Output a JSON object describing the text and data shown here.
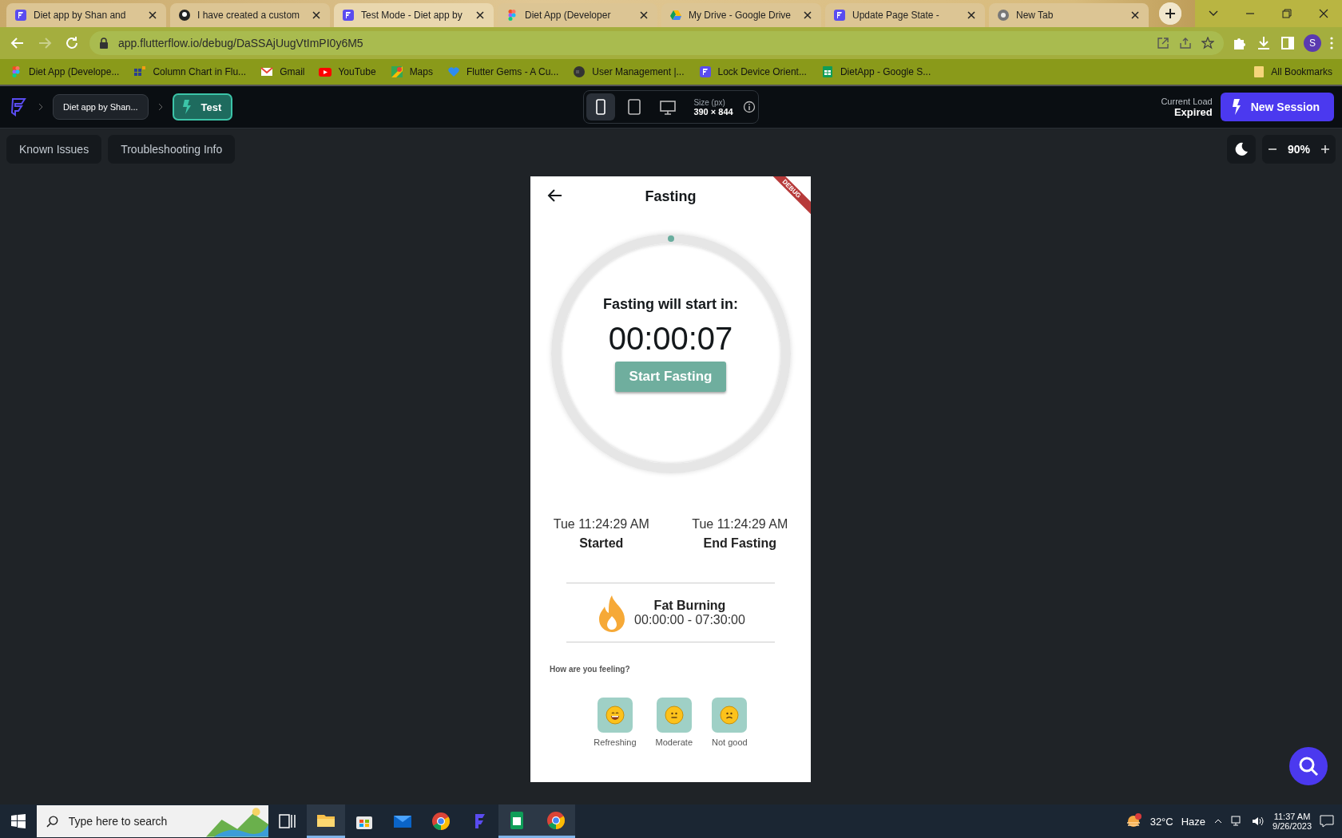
{
  "browser": {
    "tabs": [
      {
        "title": "Diet app by Shan and",
        "kind": "flutterflow",
        "selected": false
      },
      {
        "title": "I have created a custom",
        "kind": "github",
        "selected": false
      },
      {
        "title": "Test Mode - Diet app by",
        "kind": "flutterflow",
        "selected": true
      },
      {
        "title": "Diet App (Developer",
        "kind": "figma",
        "selected": false
      },
      {
        "title": "My Drive - Google Drive",
        "kind": "drive",
        "selected": false
      },
      {
        "title": "Update Page State -",
        "kind": "flutterflow",
        "selected": false
      },
      {
        "title": "New Tab",
        "kind": "chrome",
        "selected": false
      }
    ],
    "url": "app.flutterflow.io/debug/DaSSAjUugVtImPI0y6M5",
    "profile": "S",
    "bookmarks": [
      {
        "label": "Diet App (Develope...",
        "kind": "figma"
      },
      {
        "label": "Column Chart in Flu...",
        "kind": "grid"
      },
      {
        "label": "Gmail",
        "kind": "gmail"
      },
      {
        "label": "YouTube",
        "kind": "youtube"
      },
      {
        "label": "Maps",
        "kind": "maps"
      },
      {
        "label": "Flutter Gems - A Cu...",
        "kind": "heart"
      },
      {
        "label": "User Management |...",
        "kind": "globe"
      },
      {
        "label": "Lock Device Orient...",
        "kind": "flutterflow"
      },
      {
        "label": "DietApp - Google S...",
        "kind": "sheets"
      }
    ],
    "all_bookmarks": "All Bookmarks"
  },
  "app_header": {
    "project": "Diet app by Shan...",
    "mode": "Test",
    "devices": [
      {
        "kind": "phone",
        "selected": true
      },
      {
        "kind": "tablet",
        "selected": false
      },
      {
        "kind": "desktop",
        "selected": false
      }
    ],
    "size_label": "Size (px)",
    "size_value": "390 × 844",
    "load_label": "Current Load",
    "load_value": "Expired",
    "new_session": "New Session"
  },
  "toolbar": {
    "buttons": [
      "Known Issues",
      "Troubleshooting Info"
    ],
    "zoom": "90%"
  },
  "phone": {
    "title": "Fasting",
    "debug": "DEBUG",
    "countdown_label": "Fasting will start in:",
    "countdown": "00:00:07",
    "start_button": "Start Fasting",
    "times": [
      {
        "time": "Tue 11:24:29 AM",
        "label": "Started"
      },
      {
        "time": "Tue 11:24:29 AM",
        "label": "End Fasting"
      }
    ],
    "phase": {
      "name": "Fat Burning",
      "range": "00:00:00 - 07:30:00"
    },
    "feeling_prompt": "How are you feeling?",
    "moods": [
      {
        "label": "Refreshing",
        "kind": "grin"
      },
      {
        "label": "Moderate",
        "kind": "neutral"
      },
      {
        "label": "Not good",
        "kind": "frown"
      }
    ]
  },
  "taskbar": {
    "search_placeholder": "Type here to search",
    "apps": [
      {
        "kind": "taskview",
        "active": false
      },
      {
        "kind": "explorer",
        "active": true
      },
      {
        "kind": "store",
        "active": false
      },
      {
        "kind": "mail",
        "active": false
      },
      {
        "kind": "chrome",
        "active": false
      },
      {
        "kind": "flutterflow",
        "active": false
      },
      {
        "kind": "sheets",
        "active": true
      },
      {
        "kind": "chrome",
        "active": true
      }
    ],
    "temperature": "32°C",
    "weather": "Haze",
    "time": "11:37 AM",
    "date": "9/26/2023"
  }
}
